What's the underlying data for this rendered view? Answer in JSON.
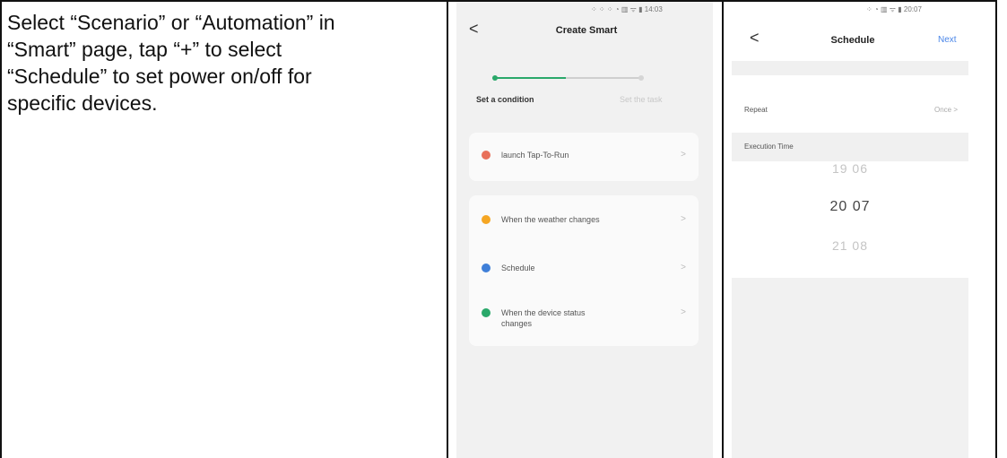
{
  "instruction": {
    "lines": [
      "Select “Scenario” or “Automation” in",
      "“Smart” page, tap “+” to select",
      "“Schedule” to set power on/off for",
      "specific devices."
    ]
  },
  "phone1": {
    "status_text": "⁘ ⁘ ⁘ ◔ ▥ ᯤ ▮ 14:03",
    "back_glyph": "<",
    "title": "Create Smart",
    "step_active": "Set a condition",
    "step_inactive": "Set the task",
    "card_top": [
      {
        "label": "launch Tap-To-Run",
        "icon_color": "#e8705a"
      }
    ],
    "card_bottom": [
      {
        "label": "When the weather changes",
        "icon_color": "#f5a623"
      },
      {
        "label": "Schedule",
        "icon_color": "#3f7fd8"
      },
      {
        "label": "When the device status changes",
        "icon_color": "#2aa86a"
      }
    ],
    "chevron": ">"
  },
  "phone2": {
    "status_text": "⁘ ◔ ▥ ᯤ ▮ 20:07",
    "back_glyph": "<",
    "title": "Schedule",
    "next_label": "Next",
    "repeat_label": "Repeat",
    "repeat_value": "Once >",
    "section_label": "Execution Time",
    "times": [
      "19 06",
      "20 07",
      "21 08"
    ]
  },
  "colors": {
    "accent": "#4a86e8",
    "stepper_active": "#2aa86a",
    "card_bg": "#fafafa",
    "phone_bg": "#f1f1f1"
  }
}
